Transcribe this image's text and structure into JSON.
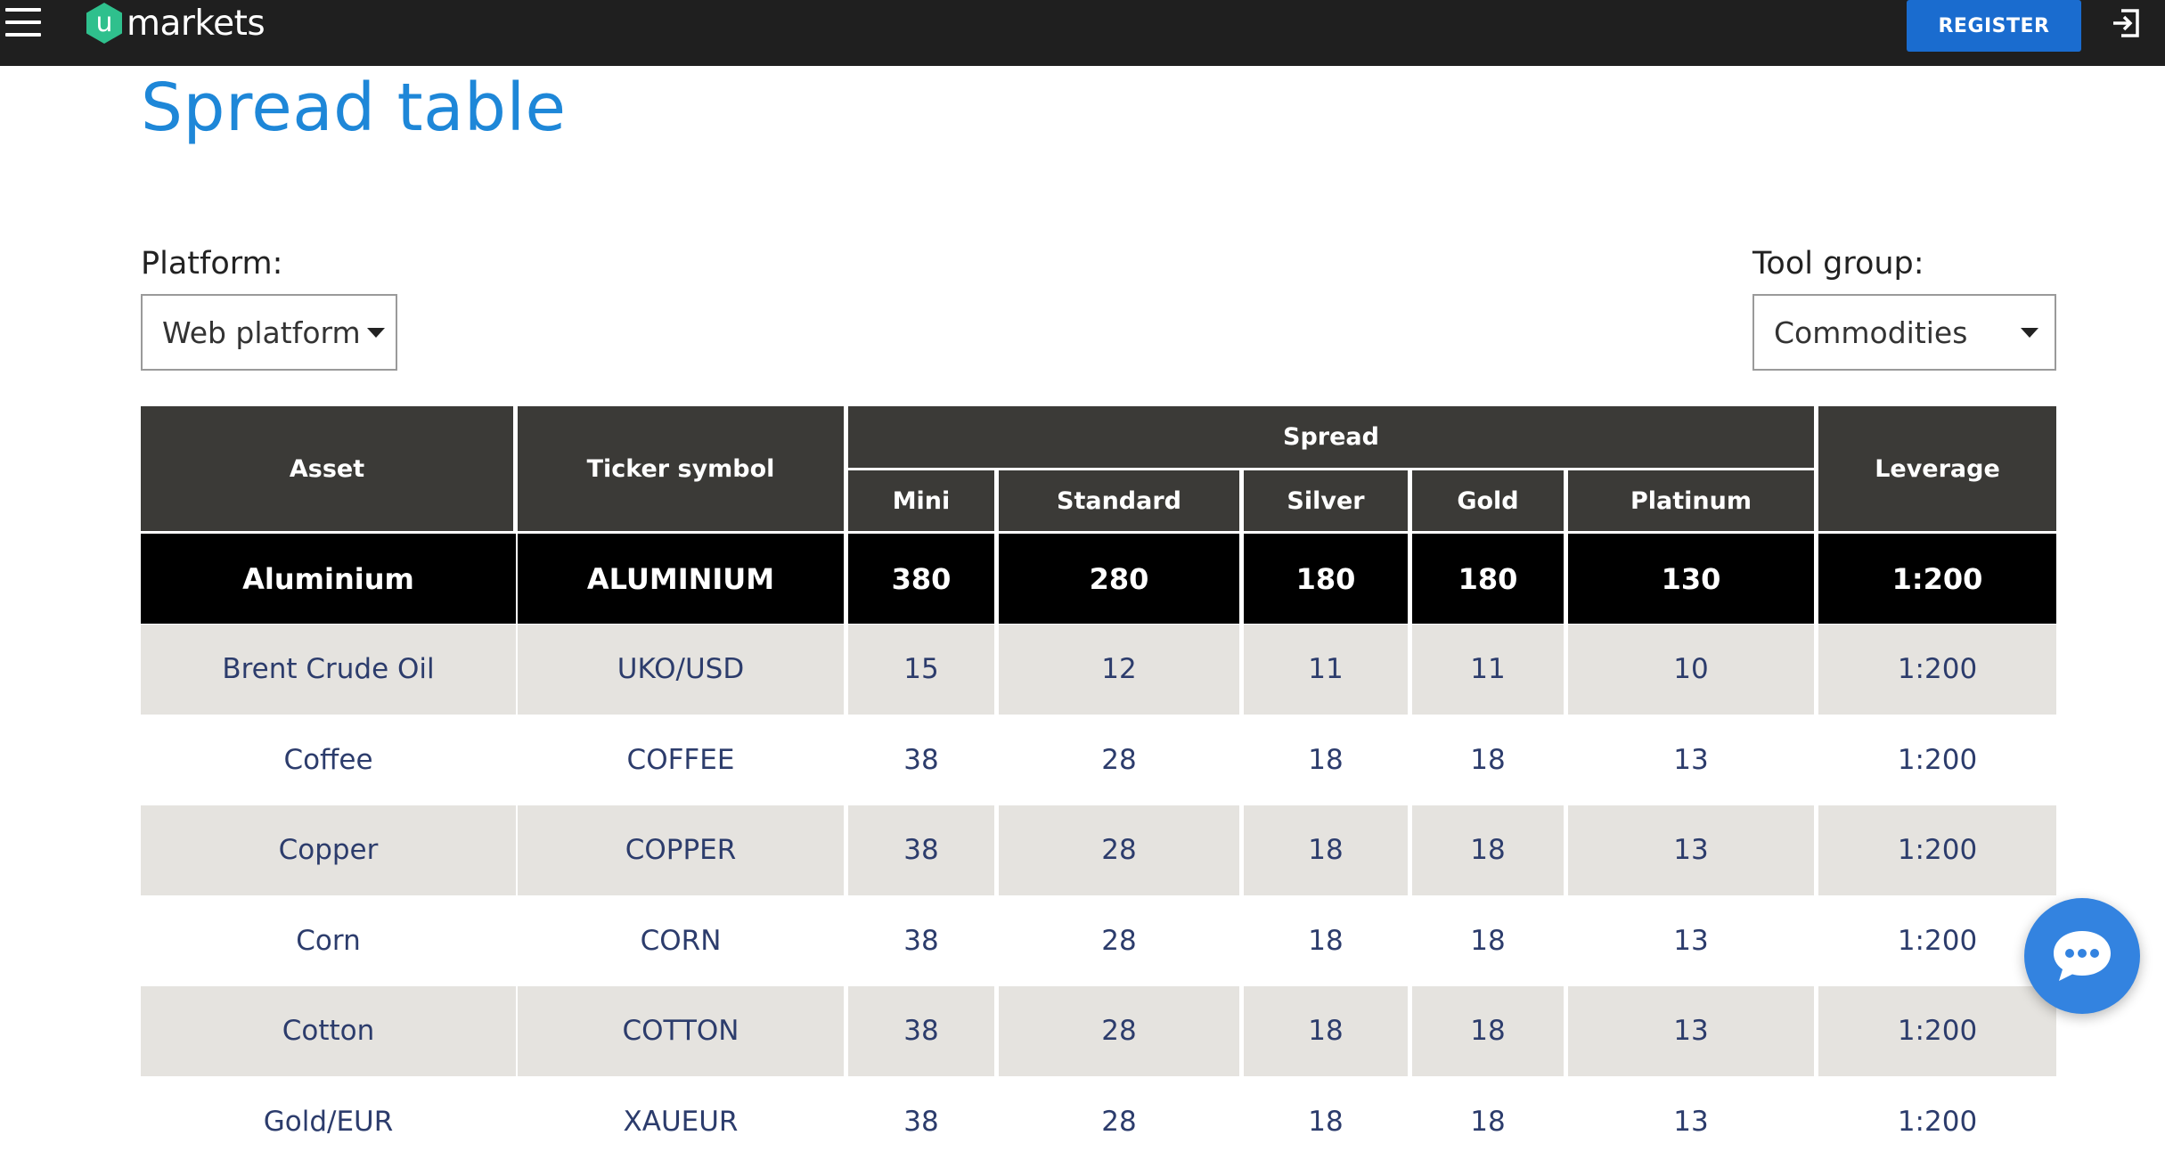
{
  "header": {
    "logo_text": "markets",
    "logo_letter": "u",
    "register_label": "REGISTER"
  },
  "page": {
    "title": "Spread table"
  },
  "filters": {
    "platform_label": "Platform:",
    "platform_value": "Web platform",
    "tool_group_label": "Tool group:",
    "tool_group_value": "Commodities"
  },
  "table": {
    "headers": {
      "asset": "Asset",
      "ticker": "Ticker symbol",
      "spread": "Spread",
      "leverage": "Leverage",
      "tiers": [
        "Mini",
        "Standard",
        "Silver",
        "Gold",
        "Platinum"
      ]
    },
    "rows": [
      [
        "Aluminium",
        "ALUMINIUM",
        "380",
        "280",
        "180",
        "180",
        "130",
        "1:200"
      ],
      [
        "Brent Crude Oil",
        "UKO/USD",
        "15",
        "12",
        "11",
        "11",
        "10",
        "1:200"
      ],
      [
        "Coffee",
        "COFFEE",
        "38",
        "28",
        "18",
        "18",
        "13",
        "1:200"
      ],
      [
        "Copper",
        "COPPER",
        "38",
        "28",
        "18",
        "18",
        "13",
        "1:200"
      ],
      [
        "Corn",
        "CORN",
        "38",
        "28",
        "18",
        "18",
        "13",
        "1:200"
      ],
      [
        "Cotton",
        "COTTON",
        "38",
        "28",
        "18",
        "18",
        "13",
        "1:200"
      ],
      [
        "Gold/EUR",
        "XAUEUR",
        "38",
        "28",
        "18",
        "18",
        "13",
        "1:200"
      ]
    ]
  },
  "icons": {
    "menu": "hamburger-menu-icon",
    "login": "login-icon",
    "chat": "chat-bubble-icon",
    "dropdown": "caret-down-icon"
  },
  "colors": {
    "accent": "#1e87d8",
    "register": "#1a6ccf",
    "topbar": "#1f1f1f",
    "header_cell": "#3b3a37",
    "highlight_row": "#000000",
    "row_alt": "#e5e3df",
    "body_text": "#2c3c6c",
    "logo_green": "#2fc08d",
    "chat": "#3383e0"
  }
}
